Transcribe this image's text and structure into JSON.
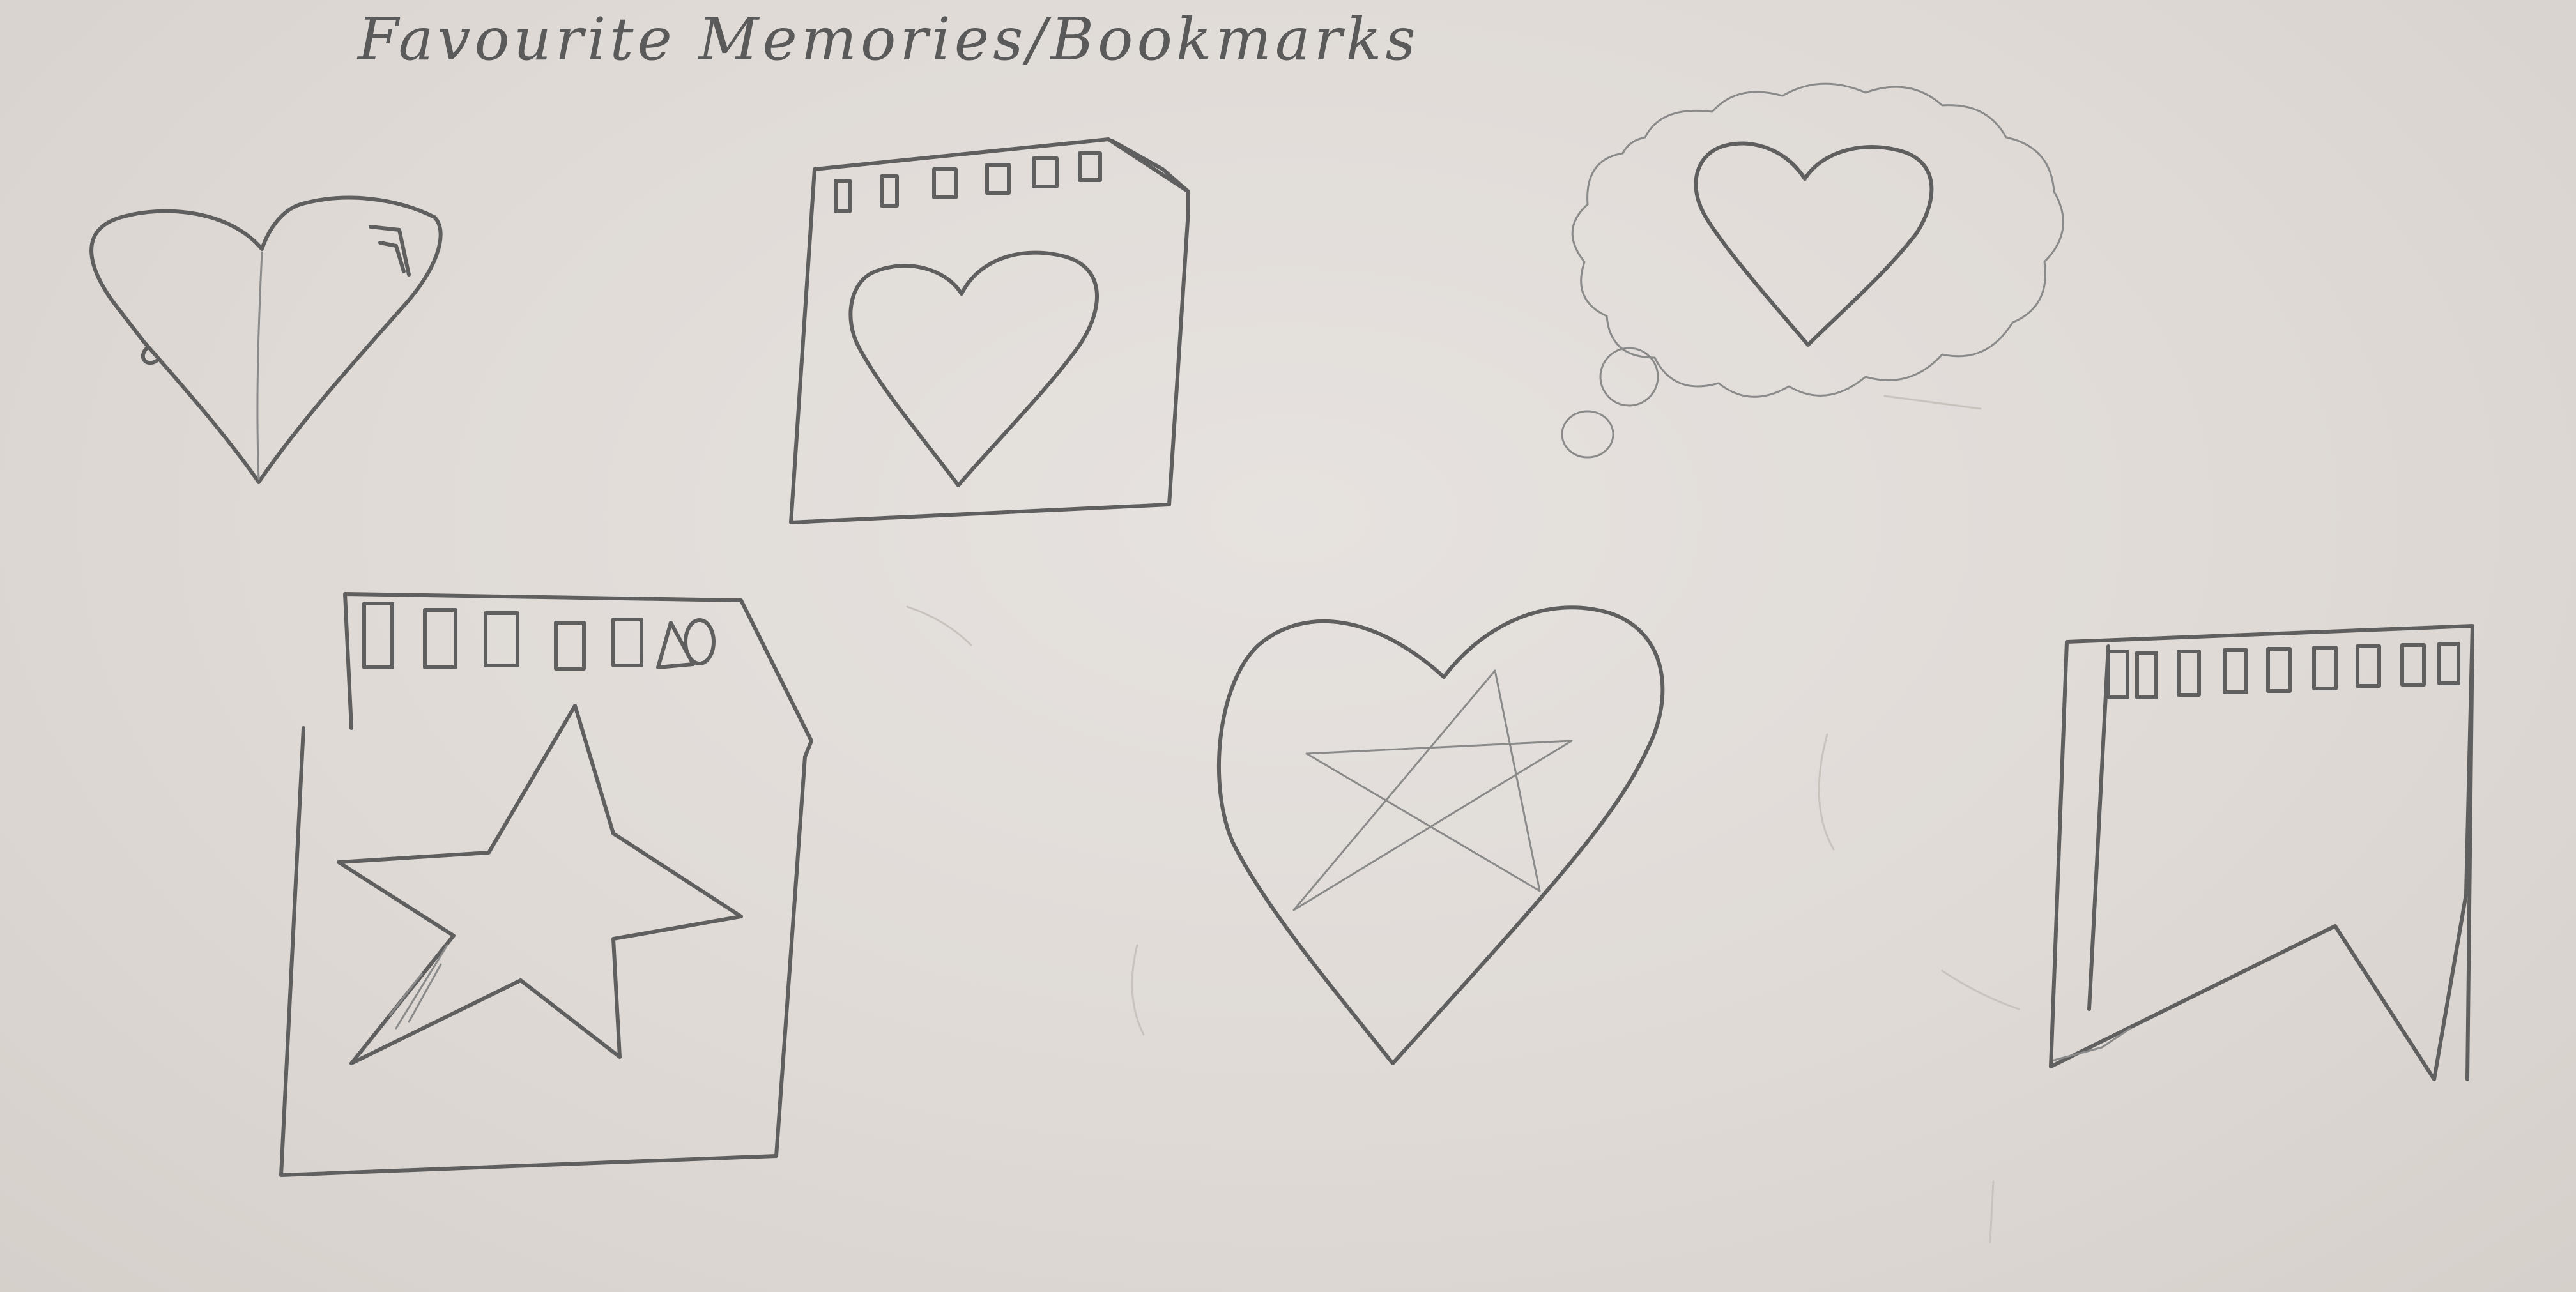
{
  "title": "Favourite Memories/Bookmarks",
  "sketches": [
    {
      "name": "folded-heart-icon",
      "depicts": "folded paper heart"
    },
    {
      "name": "photo-heart-icon",
      "depicts": "film frame with heart"
    },
    {
      "name": "thought-bubble-heart-icon",
      "depicts": "thought bubble with heart"
    },
    {
      "name": "photo-star-icon",
      "depicts": "film frame with star"
    },
    {
      "name": "heart-star-icon",
      "depicts": "heart with star inside"
    },
    {
      "name": "film-bookmark-icon",
      "depicts": "film strip bookmark ribbon"
    }
  ]
}
